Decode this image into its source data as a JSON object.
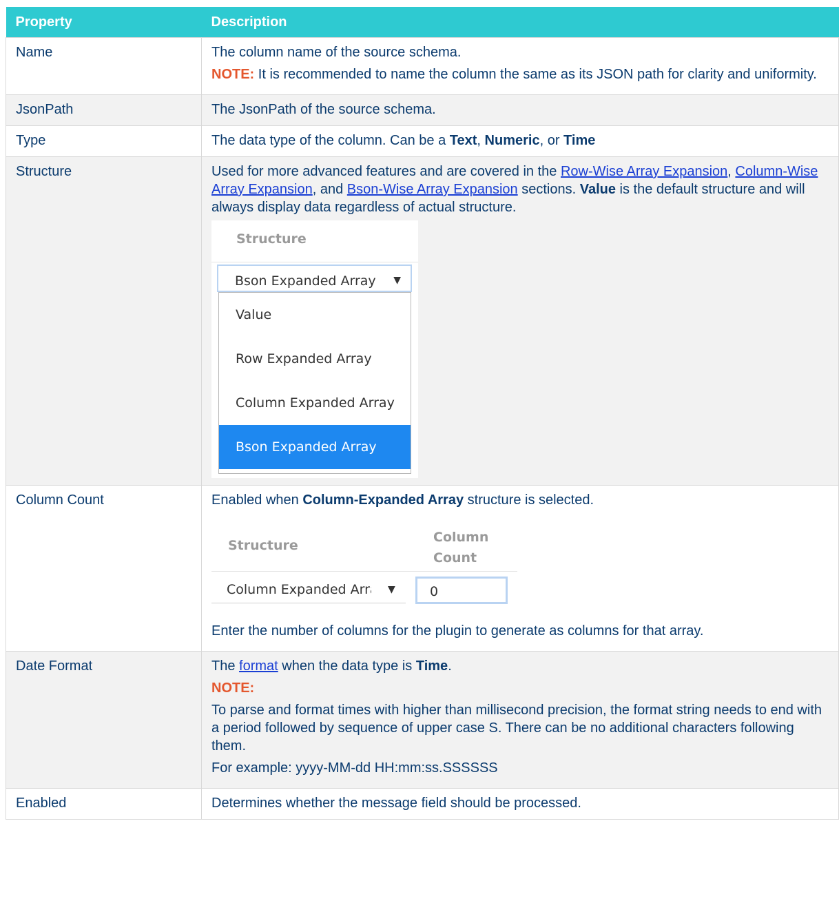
{
  "header": {
    "property": "Property",
    "description": "Description"
  },
  "rows": {
    "name": {
      "property": "Name",
      "desc": "The column name of the source schema.",
      "note_label": "NOTE:",
      "note_text": " It is recommended to name the column the same as its JSON path for clarity and uniformity."
    },
    "jsonpath": {
      "property": "JsonPath",
      "desc": "The JsonPath of the source schema."
    },
    "type": {
      "property": "Type",
      "desc_prefix": "The data type of the column. Can be a ",
      "t1": "Text",
      "sep1": ", ",
      "t2": "Numeric",
      "sep2": ", or ",
      "t3": "Time"
    },
    "structure": {
      "property": "Structure",
      "desc_prefix": "Used for more advanced features and are covered in the ",
      "link1": "Row-Wise Array Expansion",
      "sep1": ", ",
      "link2": "Column-Wise Array Expansion",
      "sep2": ", and ",
      "link3": "Bson-Wise Array Expansion",
      "desc_mid": " sections. ",
      "value_bold": "Value",
      "desc_suffix": " is the default structure and will always display data regardless of actual structure.",
      "shot": {
        "header": "Structure",
        "selected": "Bson Expanded Array",
        "options": [
          "Value",
          "Row Expanded Array",
          "Column Expanded Array",
          "Bson Expanded Array"
        ]
      }
    },
    "column_count": {
      "property": "Column Count",
      "desc_prefix": "Enabled when ",
      "bold": "Column-Expanded Array",
      "desc_suffix": " structure is selected.",
      "shot": {
        "header1": "Structure",
        "header2_line1": "Column",
        "header2_line2": "Count",
        "selected": "Column Expanded Array",
        "input_value": "0"
      },
      "desc2": "Enter the number of columns for the plugin to generate as columns for that array."
    },
    "date_format": {
      "property": "Date Format",
      "desc_prefix": "The ",
      "link": "format",
      "desc_mid": " when the data type is ",
      "bold": "Time",
      "desc_suffix": ".",
      "note_label": "NOTE:",
      "note_text": "To parse and format times with higher than millisecond precision, the format string needs to end with a period followed by sequence of upper case S. There can be no additional characters following them.",
      "example": "For example: yyyy-MM-dd HH:mm:ss.SSSSSS"
    },
    "enabled": {
      "property": "Enabled",
      "desc": "Determines whether the message field should be processed."
    }
  }
}
